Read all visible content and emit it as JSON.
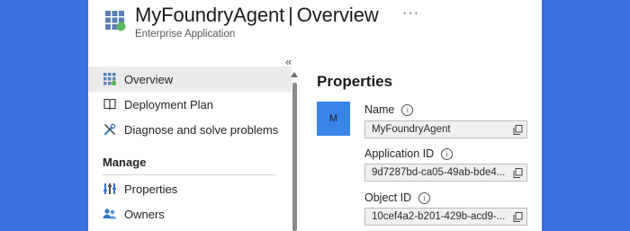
{
  "header": {
    "app_name": "MyFoundryAgent",
    "separator": "|",
    "page": "Overview",
    "more": "···",
    "subtitle": "Enterprise Application",
    "icon": "enterprise-app-icon"
  },
  "sidebar": {
    "collapse_glyph": "«",
    "items": [
      {
        "label": "Overview",
        "icon": "overview-grid-icon",
        "selected": true
      },
      {
        "label": "Deployment Plan",
        "icon": "book-icon"
      },
      {
        "label": "Diagnose and solve problems",
        "icon": "wrench-icon"
      }
    ],
    "section": "Manage",
    "manage_items": [
      {
        "label": "Properties",
        "icon": "properties-sliders-icon"
      },
      {
        "label": "Owners",
        "icon": "owners-people-icon"
      }
    ]
  },
  "main": {
    "title": "Properties",
    "avatar_initial": "M",
    "fields": [
      {
        "label": "Name",
        "value": "MyFoundryAgent"
      },
      {
        "label": "Application ID",
        "value": "9d7287bd-ca05-49ab-bde4..."
      },
      {
        "label": "Object ID",
        "value": "10cef4a2-b201-429b-acd9-..."
      }
    ]
  },
  "colors": {
    "background": "#3d6fe0",
    "avatar": "#3b84e7",
    "selected_row": "#ebebeb"
  }
}
